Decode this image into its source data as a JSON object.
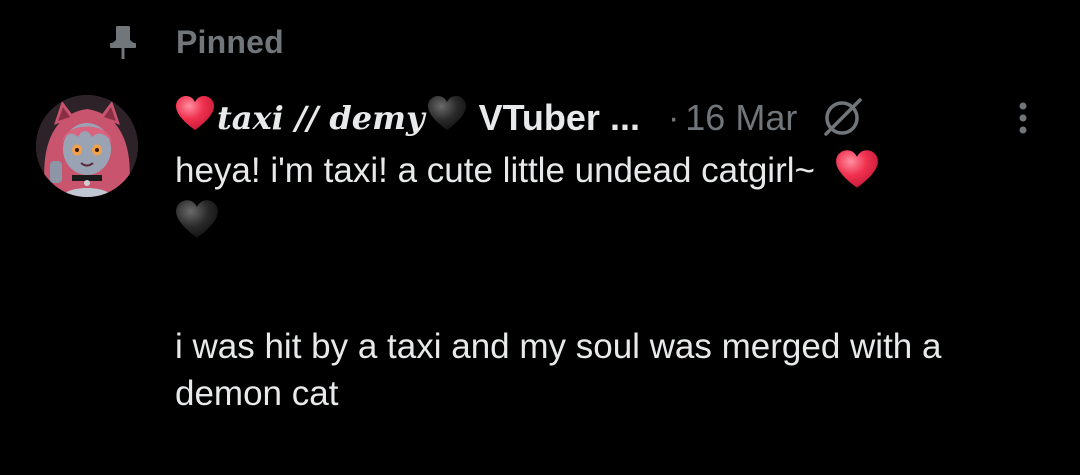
{
  "pinned": {
    "label": "Pinned",
    "icon": "pin-icon"
  },
  "author": {
    "avatar_icon": "avatar-anime-catgirl",
    "name_prefix_emoji": "red-heart-emoji",
    "name_fancy": "taxi // demy",
    "name_suffix_emoji": "black-heart-emoji",
    "name_tail": "VTuber ...",
    "separator": "·",
    "date": "16 Mar"
  },
  "header_icons": {
    "no_display": "no-display-icon",
    "more": "more-vertical-icon"
  },
  "tweet": {
    "line1": "heya! i'm taxi! a cute little undead catgirl~",
    "line1_emoji": "red-heart-emoji",
    "line2_emoji": "black-heart-emoji",
    "para2": "i was hit by a taxi and my soul was merged with a demon cat"
  },
  "colors": {
    "background": "#000000",
    "text_primary": "#e7e9ea",
    "text_secondary": "#71767b",
    "heart_red": "#f0314f",
    "heart_black": "#1c1c1c"
  }
}
